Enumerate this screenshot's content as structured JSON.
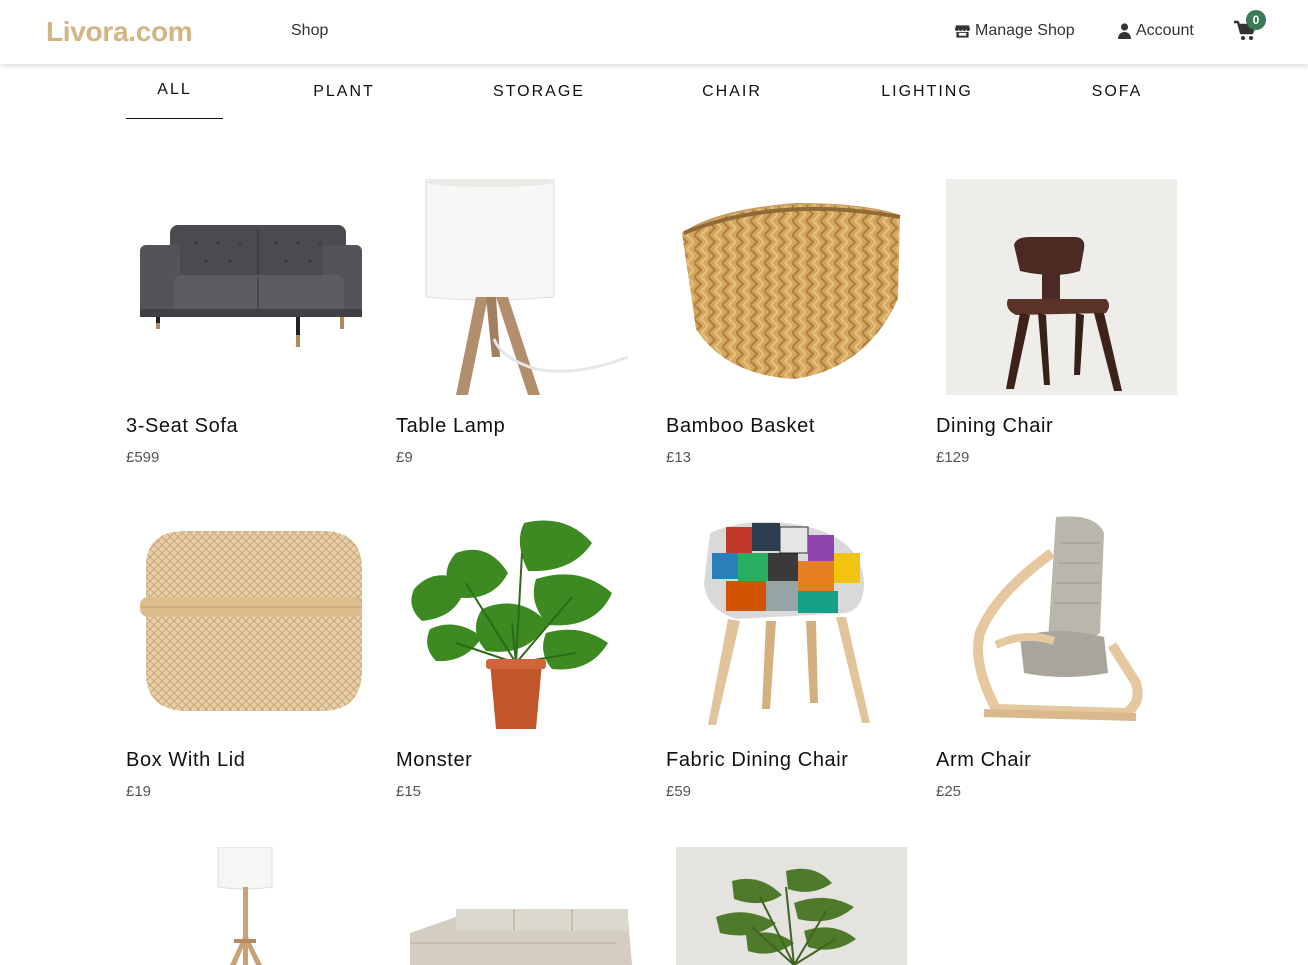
{
  "brand": {
    "name": "Livora.com",
    "color": "#d4b483"
  },
  "nav": {
    "shop_label": "Shop",
    "manage_label": "Manage Shop",
    "account_label": "Account",
    "cart_count": "0",
    "badge_color": "#3b7a57",
    "icons": [
      "store-icon",
      "user-icon",
      "shopping-cart-icon"
    ]
  },
  "categories": [
    "ALL",
    "PLANT",
    "STORAGE",
    "CHAIR",
    "LIGHTING",
    "SOFA"
  ],
  "active_category": "ALL",
  "products": [
    {
      "name": "3-Seat Sofa",
      "price": "£599",
      "image": "sofa"
    },
    {
      "name": "Table Lamp",
      "price": "£9",
      "image": "table-lamp"
    },
    {
      "name": "Bamboo Basket",
      "price": "£13",
      "image": "bamboo-basket"
    },
    {
      "name": "Dining Chair",
      "price": "£129",
      "image": "dining-chair"
    },
    {
      "name": "Box With Lid",
      "price": "£19",
      "image": "box-with-lid"
    },
    {
      "name": "Monster",
      "price": "£15",
      "image": "monstera-plant"
    },
    {
      "name": "Fabric Dining Chair",
      "price": "£59",
      "image": "patchwork-chair"
    },
    {
      "name": "Arm Chair",
      "price": "£25",
      "image": "arm-chair"
    },
    {
      "name": "",
      "price": "",
      "image": "floor-lamp"
    },
    {
      "name": "",
      "price": "",
      "image": "corner-sofa"
    },
    {
      "name": "",
      "price": "",
      "image": "potted-plant"
    }
  ]
}
